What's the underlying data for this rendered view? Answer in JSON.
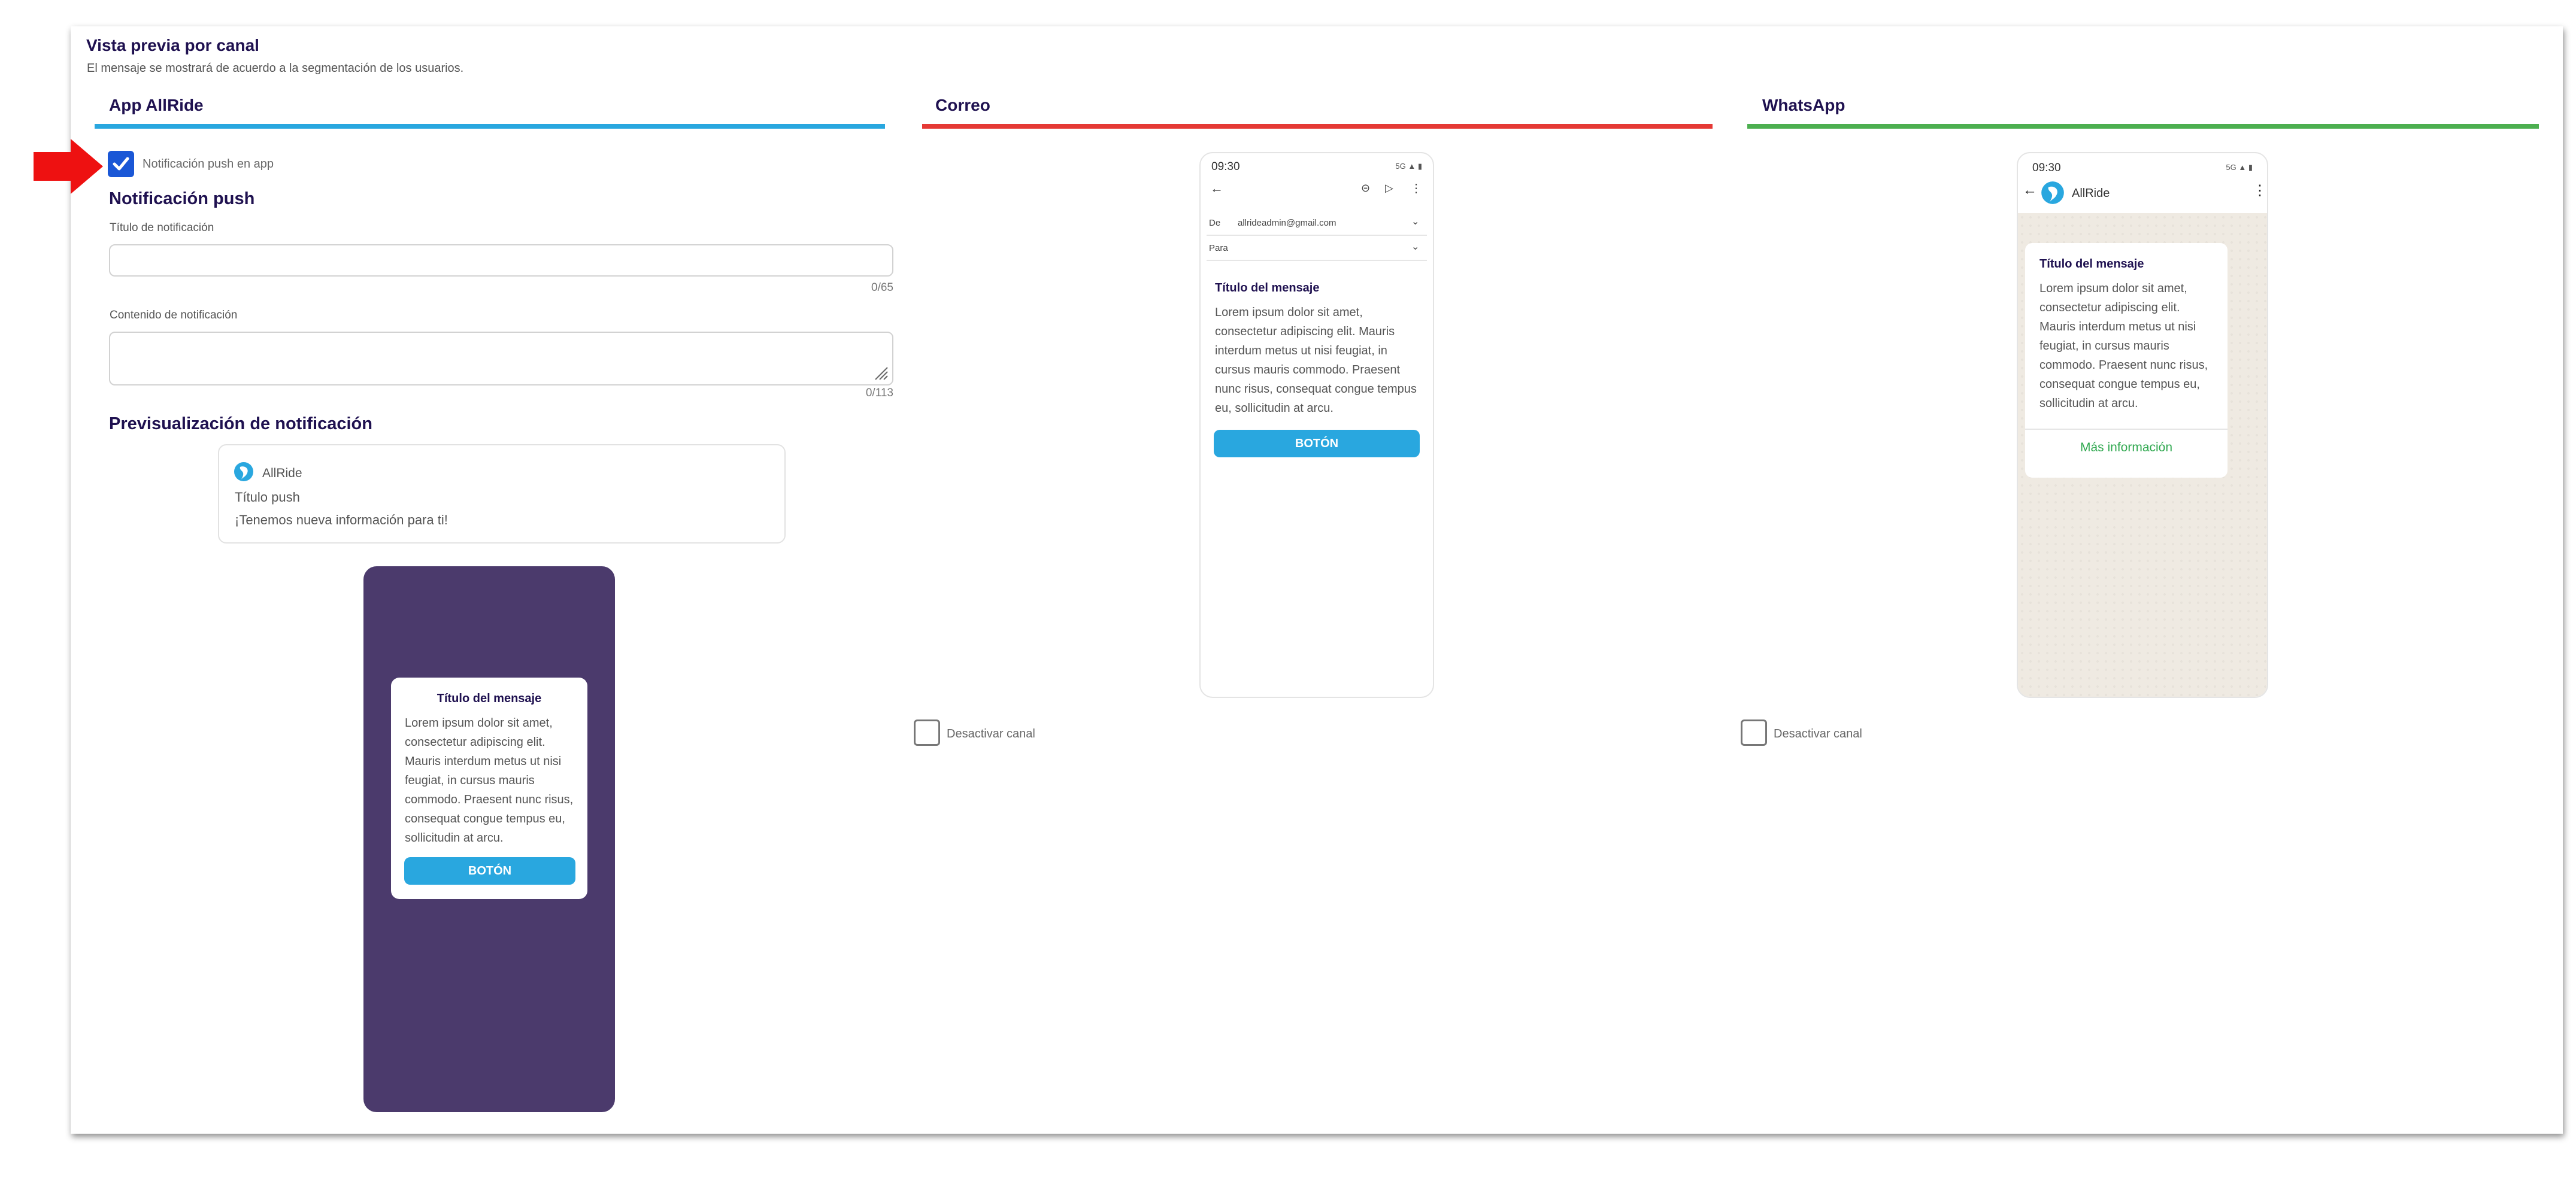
{
  "page": {
    "title": "Vista previa por canal",
    "subtitle": "El mensaje se mostrará de acuerdo a la segmentación de los usuarios."
  },
  "colors": {
    "brand_dark": "#1f1150",
    "tab_app": "#29a7df",
    "tab_email": "#e53935",
    "tab_whatsapp": "#4caf50",
    "button_blue": "#29a7df",
    "checkbox_checked": "#1a57d6",
    "arrow_red": "#ee1111",
    "inapp_background": "#4b3a6c",
    "whatsapp_link": "#2fa84f"
  },
  "tabs": {
    "app": "App AllRide",
    "email": "Correo",
    "whatsapp": "WhatsApp"
  },
  "app_channel": {
    "push_checkbox_label": "Notificación push en app",
    "push_checkbox_checked": true,
    "push_section_title": "Notificación push",
    "title_field_label": "Título de notificación",
    "title_field_value": "",
    "title_counter": "0/65",
    "content_field_label": "Contenido de notificación",
    "content_field_value": "",
    "content_counter": "0/113",
    "preview_title": "Previsualización de notificación",
    "notification": {
      "app_name": "AllRide",
      "title": "Título push",
      "body": "¡Tenemos nueva información para ti!"
    },
    "inapp": {
      "title": "Título del mensaje",
      "body": "Lorem ipsum dolor sit amet, consectetur adipiscing elit. Mauris interdum metus ut nisi feugiat, in cursus mauris commodo. Praesent nunc risus, consequat congue tempus eu, sollicitudin at arcu.",
      "button": "BOTÓN"
    }
  },
  "email_channel": {
    "status_time": "09:30",
    "status_icons": "5G ▲ ▮",
    "from_label": "De",
    "from_value": "allrideadmin@gmail.com",
    "to_label": "Para",
    "message_title": "Título del mensaje",
    "message_body": "Lorem ipsum dolor sit amet, consectetur adipiscing elit. Mauris interdum metus ut nisi feugiat, in cursus mauris commodo. Praesent nunc risus, consequat congue tempus eu, sollicitudin at arcu.",
    "button": "BOTÓN",
    "disable_label": "Desactivar canal",
    "disable_checked": false
  },
  "whatsapp_channel": {
    "status_time": "09:30",
    "status_icons": "5G ▲ ▮",
    "contact_name": "AllRide",
    "message_title": "Título del mensaje",
    "message_body": "Lorem ipsum dolor sit amet, consectetur adipiscing elit. Mauris interdum metus ut nisi feugiat, in cursus mauris commodo. Praesent nunc risus, consequat congue tempus eu, sollicitudin at arcu.",
    "link": "Más información",
    "disable_label": "Desactivar canal",
    "disable_checked": false
  }
}
